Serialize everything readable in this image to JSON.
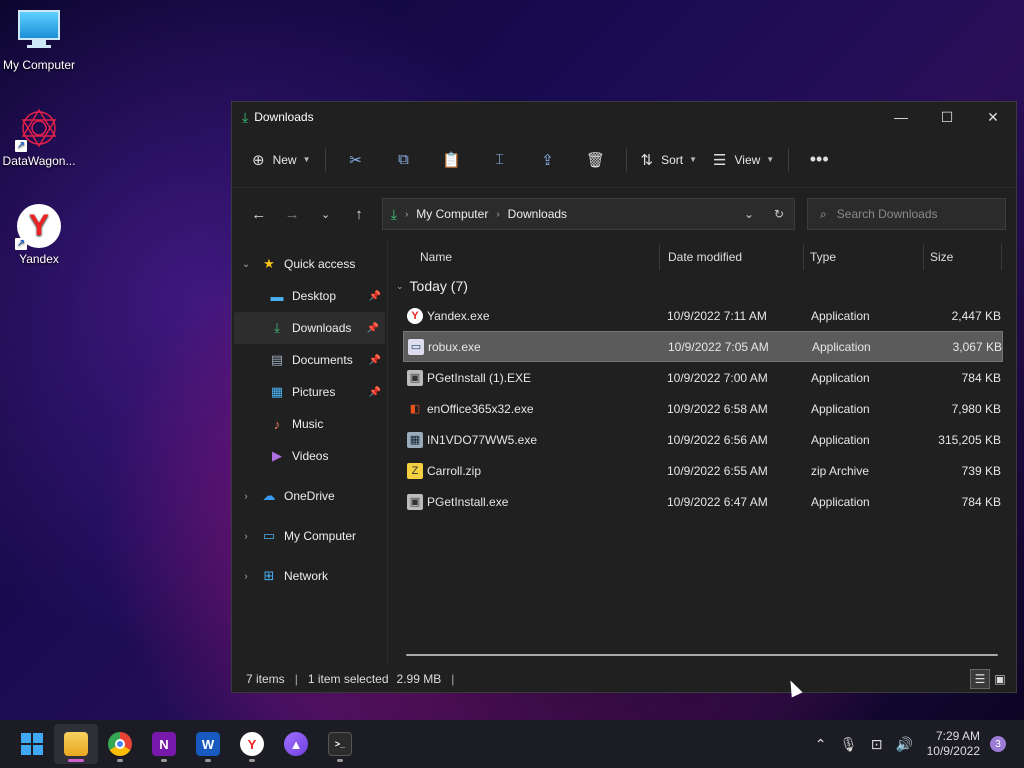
{
  "desktop": {
    "icons": [
      {
        "label": "My Computer"
      },
      {
        "label": "DataWagon..."
      },
      {
        "label": "Yandex"
      }
    ]
  },
  "window": {
    "title": "Downloads",
    "toolbar": {
      "new_label": "New",
      "sort_label": "Sort",
      "view_label": "View"
    },
    "address": {
      "crumbs": [
        "My Computer",
        "Downloads"
      ]
    },
    "search": {
      "placeholder": "Search Downloads"
    },
    "sidebar": {
      "items": [
        {
          "label": "Quick access"
        },
        {
          "label": "Desktop"
        },
        {
          "label": "Downloads"
        },
        {
          "label": "Documents"
        },
        {
          "label": "Pictures"
        },
        {
          "label": "Music"
        },
        {
          "label": "Videos"
        },
        {
          "label": "OneDrive"
        },
        {
          "label": "My Computer"
        },
        {
          "label": "Network"
        }
      ]
    },
    "columns": {
      "name": "Name",
      "date": "Date modified",
      "type": "Type",
      "size": "Size"
    },
    "group": "Today (7)",
    "files": [
      {
        "name": "Yandex.exe",
        "date": "10/9/2022 7:11 AM",
        "type": "Application",
        "size": "2,447 KB"
      },
      {
        "name": "robux.exe",
        "date": "10/9/2022 7:05 AM",
        "type": "Application",
        "size": "3,067 KB"
      },
      {
        "name": "PGetInstall (1).EXE",
        "date": "10/9/2022 7:00 AM",
        "type": "Application",
        "size": "784 KB"
      },
      {
        "name": "enOffice365x32.exe",
        "date": "10/9/2022 6:58 AM",
        "type": "Application",
        "size": "7,980 KB"
      },
      {
        "name": "IN1VDO77WW5.exe",
        "date": "10/9/2022 6:56 AM",
        "type": "Application",
        "size": "315,205 KB"
      },
      {
        "name": "Carroll.zip",
        "date": "10/9/2022 6:55 AM",
        "type": "zip Archive",
        "size": "739 KB"
      },
      {
        "name": "PGetInstall.exe",
        "date": "10/9/2022 6:47 AM",
        "type": "Application",
        "size": "784 KB"
      }
    ],
    "status": {
      "items": "7 items",
      "selected": "1 item selected",
      "size": "2.99 MB"
    }
  },
  "taskbar": {
    "time": "7:29 AM",
    "date": "10/9/2022",
    "notifications": "3"
  }
}
